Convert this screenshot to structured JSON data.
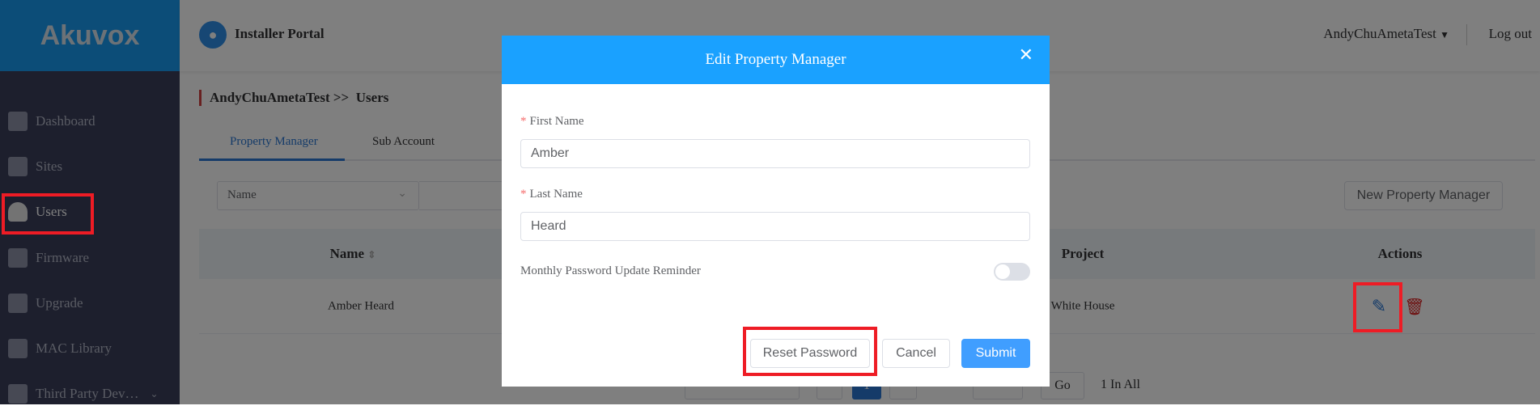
{
  "logo": "Akuvox",
  "sidebar": {
    "items": [
      {
        "label": "Dashboard",
        "icon": "dashboard-icon"
      },
      {
        "label": "Sites",
        "icon": "building-icon"
      },
      {
        "label": "Users",
        "icon": "user-icon",
        "active": true
      },
      {
        "label": "Firmware",
        "icon": "puzzle-icon"
      },
      {
        "label": "Upgrade",
        "icon": "cloud-upload-icon"
      },
      {
        "label": "MAC Library",
        "icon": "document-icon"
      },
      {
        "label": "Third Party Dev…",
        "icon": "list-icon"
      }
    ]
  },
  "header": {
    "title": "Installer Portal",
    "user": "AndyChuAmetaTest",
    "logout": "Log out"
  },
  "breadcrumb": {
    "parent": "AndyChuAmetaTest >>",
    "current": "Users"
  },
  "tabs": [
    {
      "label": "Property Manager",
      "active": true
    },
    {
      "label": "Sub Account"
    }
  ],
  "filter": {
    "field": "Name"
  },
  "new_button": "New Property Manager",
  "table": {
    "columns": [
      "Name",
      "Project",
      "Actions"
    ],
    "rows": [
      {
        "name": "Amber Heard",
        "project": "White House"
      }
    ]
  },
  "pagination": {
    "current_page": "1",
    "go": "Go",
    "total": "1 In All"
  },
  "modal": {
    "title": "Edit Property Manager",
    "first_name_label": "First Name",
    "first_name": "Amber",
    "last_name_label": "Last Name",
    "last_name": "Heard",
    "reminder_label": "Monthly Password Update Reminder",
    "reminder_on": false,
    "reset": "Reset Password",
    "cancel": "Cancel",
    "submit": "Submit"
  },
  "colors": {
    "accent": "#1aa1ff",
    "primary_button": "#409eff",
    "highlight": "#ee1c25"
  }
}
